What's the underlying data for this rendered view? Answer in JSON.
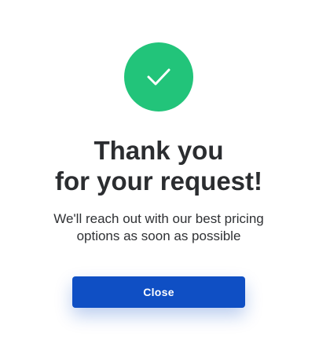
{
  "colors": {
    "success": "#22c47a",
    "primary": "#0f4fc4",
    "text": "#2b2d30",
    "background": "#ffffff"
  },
  "icon": {
    "name": "checkmark-icon"
  },
  "heading": {
    "line1": "Thank you",
    "line2": "for your request!"
  },
  "message": {
    "line1": "We'll reach out with our best pricing",
    "line2": "options as soon as possible"
  },
  "buttons": {
    "close_label": "Close"
  }
}
